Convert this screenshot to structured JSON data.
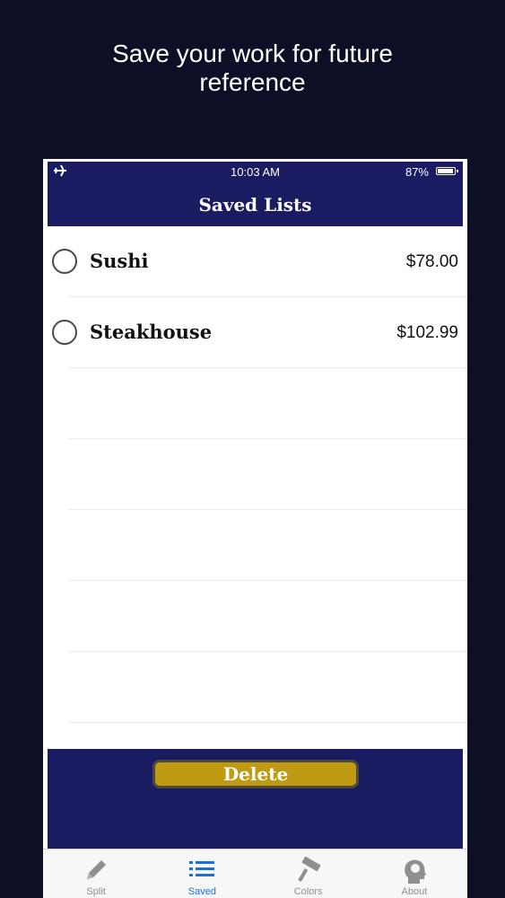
{
  "promo": {
    "line1": "Save your work for future",
    "line2": "reference"
  },
  "status_bar": {
    "time": "10:03 AM",
    "battery": "87%",
    "icons": [
      "airplane-icon",
      "battery-icon"
    ]
  },
  "nav": {
    "title": "Saved Lists"
  },
  "lists": [
    {
      "name": "Sushi",
      "price": "$78.00"
    },
    {
      "name": "Steakhouse",
      "price": "$102.99"
    }
  ],
  "actions": {
    "delete_label": "Delete"
  },
  "tabs": [
    {
      "label": "Split",
      "icon": "pencil-icon",
      "active": false
    },
    {
      "label": "Saved",
      "icon": "list-icon",
      "active": true
    },
    {
      "label": "Colors",
      "icon": "paint-roller-icon",
      "active": false
    },
    {
      "label": "About",
      "icon": "head-icon",
      "active": false
    }
  ],
  "colors": {
    "background": "#0d0f26",
    "navy": "#1a1b60",
    "gold": "#bf9a12",
    "tab_active": "#1a6fe0",
    "tab_inactive": "#8e8e93"
  }
}
